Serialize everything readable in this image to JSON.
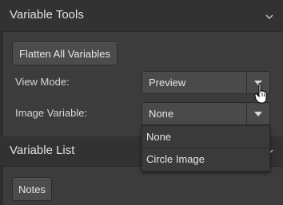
{
  "variable_tools": {
    "title": "Variable Tools",
    "flatten_button": "Flatten All Variables",
    "view_mode": {
      "label": "View Mode:",
      "value": "Preview"
    },
    "image_variable": {
      "label": "Image Variable:",
      "value": "None",
      "options": [
        "None",
        "Circle Image"
      ]
    }
  },
  "variable_list": {
    "title": "Variable List",
    "notes_button": "Notes"
  },
  "icons": {
    "collapse": "chevron-down-icon",
    "dropdown": "triangle-down-icon",
    "cursor": "hand-pointer-icon"
  },
  "colors": {
    "panel_bg": "#3c3c3c",
    "header_bg": "#323232",
    "button_bg": "#4c4c4c",
    "text": "#e0e0e0"
  }
}
